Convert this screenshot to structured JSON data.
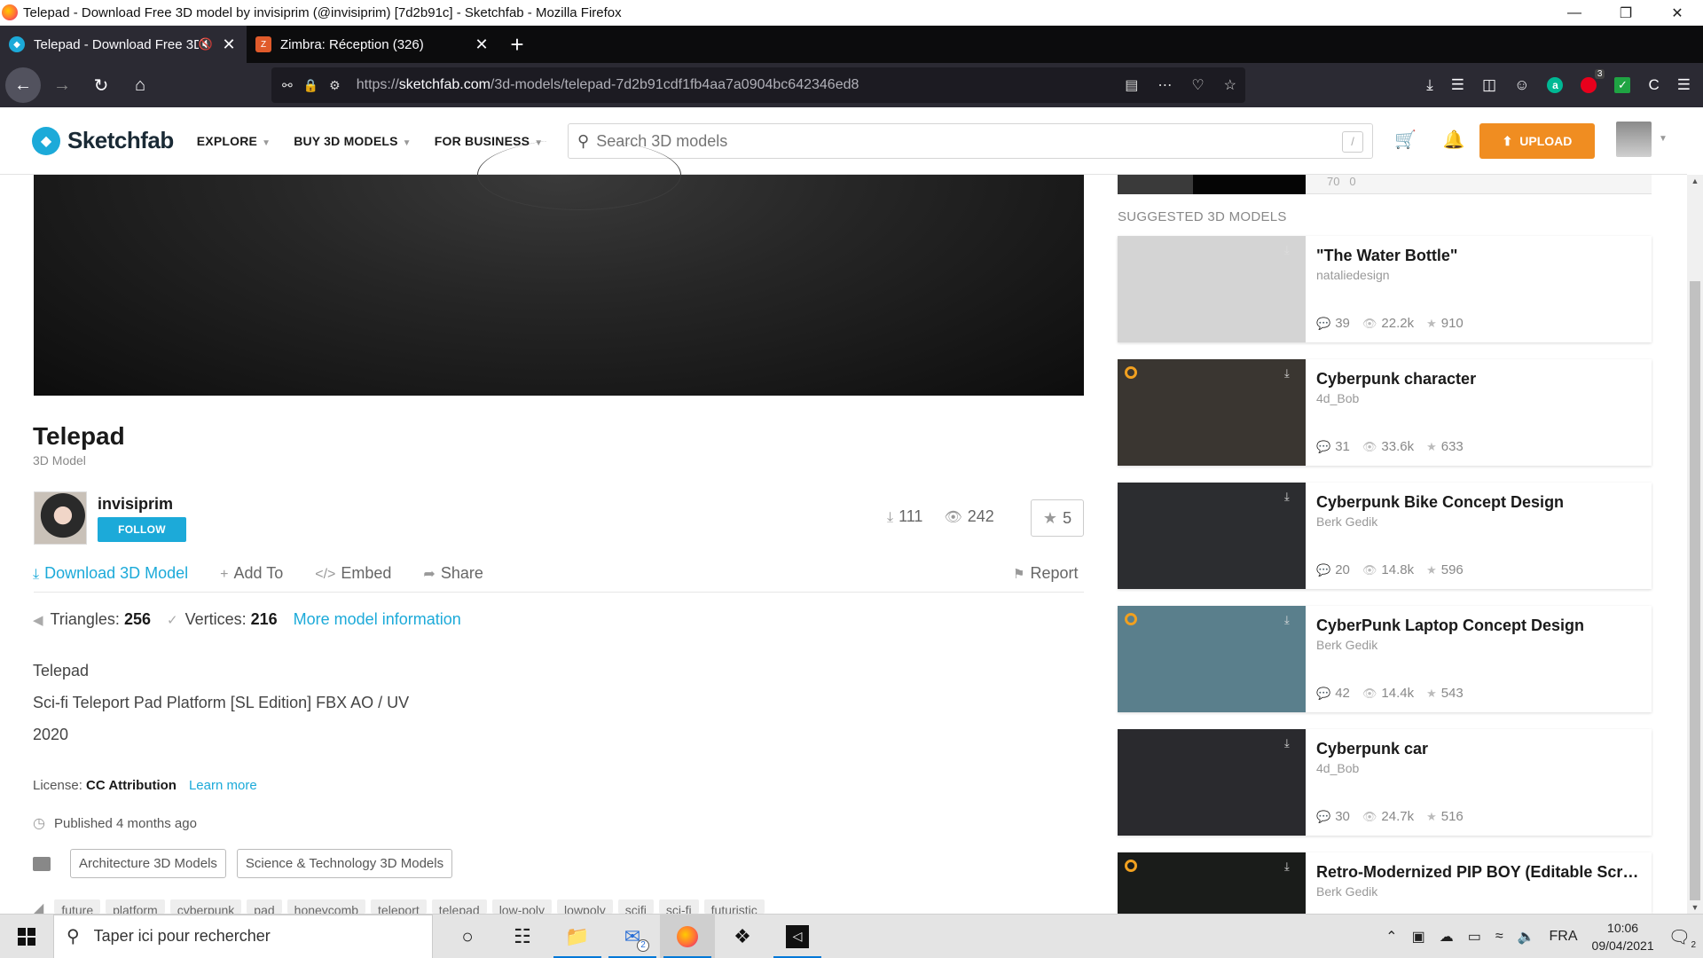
{
  "window": {
    "title": "Telepad - Download Free 3D model by invisiprim (@invisiprim) [7d2b91c] - Sketchfab - Mozilla Firefox"
  },
  "tabs": [
    {
      "label": "Telepad - Download Free 3D",
      "active": true
    },
    {
      "label": "Zimbra: Réception (326)",
      "active": false
    }
  ],
  "urlbar": {
    "prefix": "https://",
    "domain": "sketchfab.com",
    "path": "/3d-models/telepad-7d2b91cdf1fb4aa7a0904bc642346ed8"
  },
  "extensions": {
    "badge_count": "3"
  },
  "sketchfab": {
    "logo": "Sketchfab",
    "menu": [
      "EXPLORE",
      "BUY 3D MODELS",
      "FOR BUSINESS"
    ],
    "search_placeholder": "Search 3D models",
    "search_shortcut": "/",
    "upload_label": "UPLOAD"
  },
  "model": {
    "title": "Telepad",
    "subtitle": "3D Model",
    "author": "invisiprim",
    "follow_label": "FOLLOW",
    "downloads": "111",
    "views": "242",
    "likes": "5",
    "actions": {
      "download": "Download 3D Model",
      "add_to": "Add To",
      "embed": "Embed",
      "share": "Share",
      "report": "Report"
    },
    "triangles_label": "Triangles:",
    "triangles": "256",
    "vertices_label": "Vertices:",
    "vertices": "216",
    "more_info": "More model information",
    "description": [
      "Telepad",
      "Sci-fi Teleport Pad Platform [SL Edition] FBX AO / UV",
      "2020"
    ],
    "license_label": "License:",
    "license": "CC Attribution",
    "learn_more": "Learn more",
    "published": "Published 4 months ago",
    "categories": [
      "Architecture 3D Models",
      "Science & Technology 3D Models"
    ],
    "tags": [
      "future",
      "platform",
      "cyberpunk",
      "pad",
      "honeycomb",
      "teleport",
      "telepad",
      "low-poly",
      "lowpoly",
      "scifi",
      "sci-fi",
      "futuristic"
    ]
  },
  "previous_card": {
    "stat1": "70",
    "stat2": "0"
  },
  "suggested": {
    "heading": "SUGGESTED 3D MODELS",
    "items": [
      {
        "title": "\"The Water Bottle\"",
        "author": "nataliedesign",
        "comments": "39",
        "views": "22.2k",
        "likes": "910",
        "bg": "#d4d4d4"
      },
      {
        "title": "Cyberpunk character",
        "author": "4d_Bob",
        "comments": "31",
        "views": "33.6k",
        "likes": "633",
        "bg": "#3a3631"
      },
      {
        "title": "Cyberpunk Bike Concept Design",
        "author": "Berk Gedik",
        "comments": "20",
        "views": "14.8k",
        "likes": "596",
        "bg": "#2c2d30"
      },
      {
        "title": "CyberPunk Laptop Concept Design",
        "author": "Berk Gedik",
        "comments": "42",
        "views": "14.4k",
        "likes": "543",
        "bg": "#5a7f8c"
      },
      {
        "title": "Cyberpunk car",
        "author": "4d_Bob",
        "comments": "30",
        "views": "24.7k",
        "likes": "516",
        "bg": "#2a2a2e"
      },
      {
        "title": "Retro-Modernized PIP BOY (Editable Scre...",
        "author": "Berk Gedik",
        "comments": "",
        "views": "",
        "likes": "",
        "bg": "#1a1c1a"
      }
    ]
  },
  "taskbar": {
    "search_placeholder": "Taper ici pour rechercher",
    "mail_badge": "2",
    "lang": "FRA",
    "time": "10:06",
    "date": "09/04/2021",
    "notif_badge": "2"
  }
}
